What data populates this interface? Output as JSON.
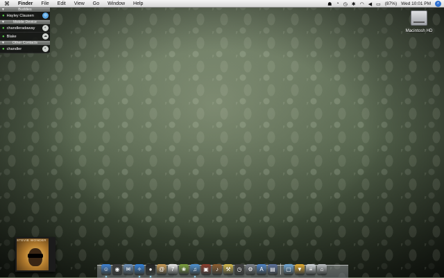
{
  "menubar": {
    "app_name": "Finder",
    "menus": [
      "File",
      "Edit",
      "View",
      "Go",
      "Window",
      "Help"
    ],
    "battery": "(87%)",
    "clock": "Wed 10:01 PM"
  },
  "buddy_list": {
    "groups": [
      {
        "name": "Buddies",
        "buddies": [
          {
            "name": "Hayley Clausen",
            "status": "available",
            "avatar": "blue"
          }
        ]
      },
      {
        "name": "Mobile Device",
        "buddies": [
          {
            "name": "chandleradaway",
            "status": "available"
          },
          {
            "name": "Blake",
            "status": "available"
          }
        ]
      },
      {
        "name": "Other Contacts",
        "buddies": [
          {
            "name": "chandler",
            "status": "available"
          }
        ]
      }
    ]
  },
  "desktop": {
    "hd_label": "Macintosh HD"
  },
  "album": {
    "artist_text": "STEVIE WONDER"
  },
  "dock": {
    "items": [
      {
        "name": "finder",
        "icon": "☺",
        "color": "#3b7fd1",
        "running": true
      },
      {
        "name": "dashboard",
        "icon": "◉",
        "color": "#3a3a3a",
        "running": false
      },
      {
        "name": "mail",
        "icon": "✉",
        "color": "#6b8fb8",
        "running": false
      },
      {
        "name": "safari",
        "icon": "✧",
        "color": "#2f7fd9",
        "running": true
      },
      {
        "name": "ichat",
        "icon": "●",
        "color": "#1f1f1f",
        "running": true
      },
      {
        "name": "address-book",
        "icon": "@",
        "color": "#c99a55",
        "running": false
      },
      {
        "name": "ical",
        "icon": "7",
        "color": "#e8e8e8",
        "running": false
      },
      {
        "name": "iphoto",
        "icon": "❀",
        "color": "#7b9f3a",
        "running": false
      },
      {
        "name": "itunes",
        "icon": "♫",
        "color": "#4a8fd0",
        "running": true
      },
      {
        "name": "photo-booth",
        "icon": "▣",
        "color": "#8a3a2a",
        "running": false
      },
      {
        "name": "garageband",
        "icon": "♪",
        "color": "#8b5a2b",
        "running": false
      },
      {
        "name": "utilities",
        "icon": "⚒",
        "color": "#d2b84a",
        "running": false
      },
      {
        "name": "time-machine",
        "icon": "◷",
        "color": "#3d3d3d",
        "running": false
      },
      {
        "name": "system-preferences",
        "icon": "⚙",
        "color": "#7a7f88",
        "running": false
      },
      {
        "name": "app-store",
        "icon": "A",
        "color": "#4d82c6",
        "running": false
      },
      {
        "name": "preview",
        "icon": "▤",
        "color": "#5a6f9a",
        "running": false
      }
    ],
    "stacks": [
      {
        "name": "applications-folder",
        "icon": "▢",
        "color": "#6fa7d8"
      },
      {
        "name": "downloads-folder",
        "icon": "▼",
        "color": "#e0a82e"
      },
      {
        "name": "documents-stack",
        "icon": "≡",
        "color": "#d0d4d9"
      },
      {
        "name": "trash",
        "icon": "⌂",
        "color": "#b9bcc0"
      }
    ]
  }
}
